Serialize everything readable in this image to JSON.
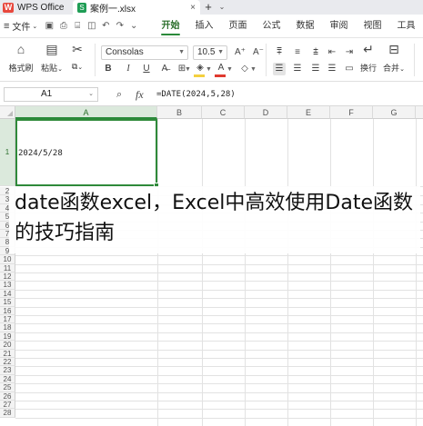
{
  "titlebar": {
    "app_tab": "WPS Office",
    "file_tab": "案例一.xlsx",
    "close_glyph": "×",
    "new_tab_glyph": "+",
    "more_glyph": "⌄",
    "brand_color": "#e8483d",
    "excel_color": "#1f9d55"
  },
  "menu": {
    "file_label": "文件",
    "tabs": [
      {
        "label": "开始",
        "active": true
      },
      {
        "label": "插入",
        "active": false
      },
      {
        "label": "页面",
        "active": false
      },
      {
        "label": "公式",
        "active": false
      },
      {
        "label": "数据",
        "active": false
      },
      {
        "label": "审阅",
        "active": false
      },
      {
        "label": "视图",
        "active": false
      },
      {
        "label": "工具",
        "active": false
      }
    ],
    "accent_color": "#2a8a3a"
  },
  "ribbon": {
    "format_painter_label": "格式刷",
    "paste_label": "粘贴",
    "font_name": "Consolas",
    "font_size": "10.5",
    "wrap_label": "换行",
    "merge_label": "合并"
  },
  "formula_bar": {
    "cell_ref": "A1",
    "fx_label": "fx",
    "formula": "=DATE(2024,5,28)"
  },
  "grid": {
    "columns": [
      "A",
      "B",
      "C",
      "D",
      "E",
      "F",
      "G"
    ],
    "rows": [
      "1",
      "2",
      "3",
      "4",
      "5",
      "6",
      "7",
      "8",
      "9",
      "10",
      "11",
      "12",
      "13",
      "14",
      "15",
      "16",
      "17",
      "18",
      "19",
      "20",
      "21",
      "22",
      "23",
      "24",
      "25",
      "26",
      "27",
      "28"
    ],
    "selected_column": "A",
    "selected_row": "1",
    "cell_a1_value": "2024/5/28"
  },
  "caption": {
    "text": "date函数excel，Excel中高效使用Date函数的技巧指南"
  }
}
